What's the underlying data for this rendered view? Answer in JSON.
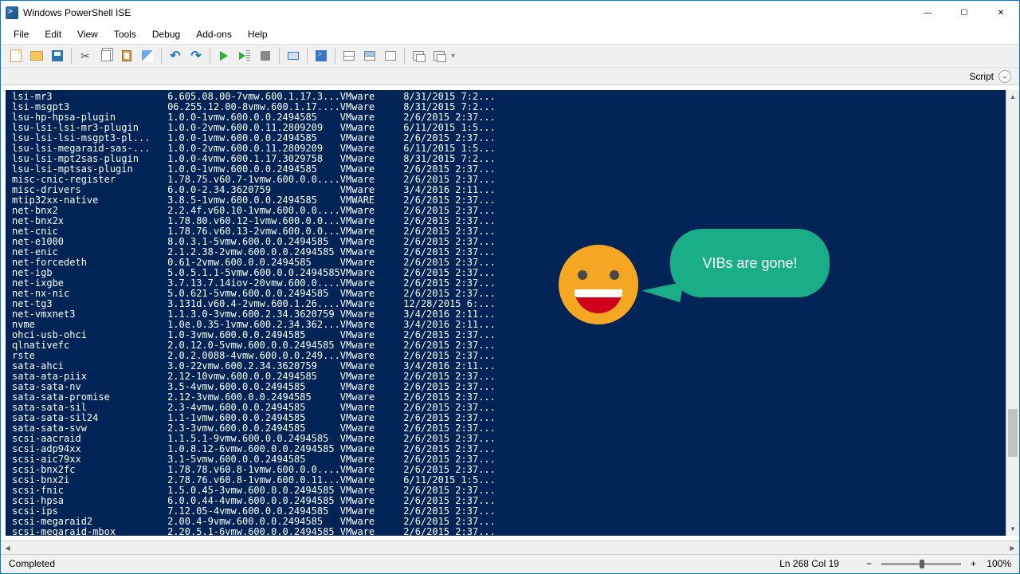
{
  "title": "Windows PowerShell ISE",
  "menu": [
    "File",
    "Edit",
    "View",
    "Tools",
    "Debug",
    "Add-ons",
    "Help"
  ],
  "script_label": "Script",
  "status": {
    "text": "Completed",
    "position": "Ln 268  Col 19",
    "zoom": "100%"
  },
  "speech": "VIBs are gone!",
  "cols": [
    0,
    27,
    57,
    68
  ],
  "rows": [
    [
      "lsi-mr3",
      "6.605.08.00-7vmw.600.1.17.3...",
      "VMware",
      "8/31/2015 7:2..."
    ],
    [
      "lsi-msgpt3",
      "06.255.12.00-8vmw.600.1.17....",
      "VMware",
      "8/31/2015 7:2..."
    ],
    [
      "lsu-hp-hpsa-plugin",
      "1.0.0-1vmw.600.0.0.2494585",
      "VMware",
      "2/6/2015 2:37..."
    ],
    [
      "lsu-lsi-lsi-mr3-plugin",
      "1.0.0-2vmw.600.0.11.2809209",
      "VMware",
      "6/11/2015 1:5..."
    ],
    [
      "lsu-lsi-lsi-msgpt3-pl...",
      "1.0.0-1vmw.600.0.0.2494585",
      "VMware",
      "2/6/2015 2:37..."
    ],
    [
      "lsu-lsi-megaraid-sas-...",
      "1.0.0-2vmw.600.0.11.2809209",
      "VMware",
      "6/11/2015 1:5..."
    ],
    [
      "lsu-lsi-mpt2sas-plugin",
      "1.0.0-4vmw.600.1.17.3029758",
      "VMware",
      "8/31/2015 7:2..."
    ],
    [
      "lsu-lsi-mptsas-plugin",
      "1.0.0-1vmw.600.0.0.2494585",
      "VMware",
      "2/6/2015 2:37..."
    ],
    [
      "misc-cnic-register",
      "1.78.75.v60.7-1vmw.600.0.0....",
      "VMware",
      "2/6/2015 2:37..."
    ],
    [
      "misc-drivers",
      "6.0.0-2.34.3620759",
      "VMware",
      "3/4/2016 2:11..."
    ],
    [
      "mtip32xx-native",
      "3.8.5-1vmw.600.0.0.2494585",
      "VMWARE",
      "2/6/2015 2:37..."
    ],
    [
      "net-bnx2",
      "2.2.4f.v60.10-1vmw.600.0.0....",
      "VMware",
      "2/6/2015 2:37..."
    ],
    [
      "net-bnx2x",
      "1.78.80.v60.12-1vmw.600.0.0...",
      "VMware",
      "2/6/2015 2:37..."
    ],
    [
      "net-cnic",
      "1.78.76.v60.13-2vmw.600.0.0...",
      "VMware",
      "2/6/2015 2:37..."
    ],
    [
      "net-e1000",
      "8.0.3.1-5vmw.600.0.0.2494585",
      "VMware",
      "2/6/2015 2:37..."
    ],
    [
      "net-enic",
      "2.1.2.38-2vmw.600.0.0.2494585",
      "VMware",
      "2/6/2015 2:37..."
    ],
    [
      "net-forcedeth",
      "0.61-2vmw.600.0.0.2494585",
      "VMware",
      "2/6/2015 2:37..."
    ],
    [
      "net-igb",
      "5.0.5.1.1-5vmw.600.0.0.2494585",
      "VMware",
      "2/6/2015 2:37..."
    ],
    [
      "net-ixgbe",
      "3.7.13.7.14iov-20vmw.600.0....",
      "VMware",
      "2/6/2015 2:37..."
    ],
    [
      "net-nx-nic",
      "5.0.621-5vmw.600.0.0.2494585",
      "VMware",
      "2/6/2015 2:37..."
    ],
    [
      "net-tg3",
      "3.131d.v60.4-2vmw.600.1.26....",
      "VMware",
      "12/28/2015 6:..."
    ],
    [
      "net-vmxnet3",
      "1.1.3.0-3vmw.600.2.34.3620759",
      "VMware",
      "3/4/2016 2:11..."
    ],
    [
      "nvme",
      "1.0e.0.35-1vmw.600.2.34.362...",
      "VMware",
      "3/4/2016 2:11..."
    ],
    [
      "ohci-usb-ohci",
      "1.0-3vmw.600.0.0.2494585",
      "VMware",
      "2/6/2015 2:37..."
    ],
    [
      "qlnativefc",
      "2.0.12.0-5vmw.600.0.0.2494585",
      "VMware",
      "2/6/2015 2:37..."
    ],
    [
      "rste",
      "2.0.2.0088-4vmw.600.0.0.249...",
      "VMware",
      "2/6/2015 2:37..."
    ],
    [
      "sata-ahci",
      "3.0-22vmw.600.2.34.3620759",
      "VMware",
      "3/4/2016 2:11..."
    ],
    [
      "sata-ata-piix",
      "2.12-10vmw.600.0.0.2494585",
      "VMware",
      "2/6/2015 2:37..."
    ],
    [
      "sata-sata-nv",
      "3.5-4vmw.600.0.0.2494585",
      "VMware",
      "2/6/2015 2:37..."
    ],
    [
      "sata-sata-promise",
      "2.12-3vmw.600.0.0.2494585",
      "VMware",
      "2/6/2015 2:37..."
    ],
    [
      "sata-sata-sil",
      "2.3-4vmw.600.0.0.2494585",
      "VMware",
      "2/6/2015 2:37..."
    ],
    [
      "sata-sata-sil24",
      "1.1-1vmw.600.0.0.2494585",
      "VMware",
      "2/6/2015 2:37..."
    ],
    [
      "sata-sata-svw",
      "2.3-3vmw.600.0.0.2494585",
      "VMware",
      "2/6/2015 2:37..."
    ],
    [
      "scsi-aacraid",
      "1.1.5.1-9vmw.600.0.0.2494585",
      "VMware",
      "2/6/2015 2:37..."
    ],
    [
      "scsi-adp94xx",
      "1.0.8.12-6vmw.600.0.0.2494585",
      "VMware",
      "2/6/2015 2:37..."
    ],
    [
      "scsi-aic79xx",
      "3.1-5vmw.600.0.0.2494585",
      "VMware",
      "2/6/2015 2:37..."
    ],
    [
      "scsi-bnx2fc",
      "1.78.78.v60.8-1vmw.600.0.0....",
      "VMware",
      "2/6/2015 2:37..."
    ],
    [
      "scsi-bnx2i",
      "2.78.76.v60.8-1vmw.600.0.11...",
      "VMware",
      "6/11/2015 1:5..."
    ],
    [
      "scsi-fnic",
      "1.5.0.45-3vmw.600.0.0.2494585",
      "VMware",
      "2/6/2015 2:37..."
    ],
    [
      "scsi-hpsa",
      "6.0.0.44-4vmw.600.0.0.2494585",
      "VMware",
      "2/6/2015 2:37..."
    ],
    [
      "scsi-ips",
      "7.12.05-4vmw.600.0.0.2494585",
      "VMware",
      "2/6/2015 2:37..."
    ],
    [
      "scsi-megaraid2",
      "2.00.4-9vmw.600.0.0.2494585",
      "VMware",
      "2/6/2015 2:37..."
    ],
    [
      "scsi-megaraid-mbox",
      "2.20.5.1-6vmw.600.0.0.2494585",
      "VMware",
      "2/6/2015 2:37..."
    ]
  ]
}
